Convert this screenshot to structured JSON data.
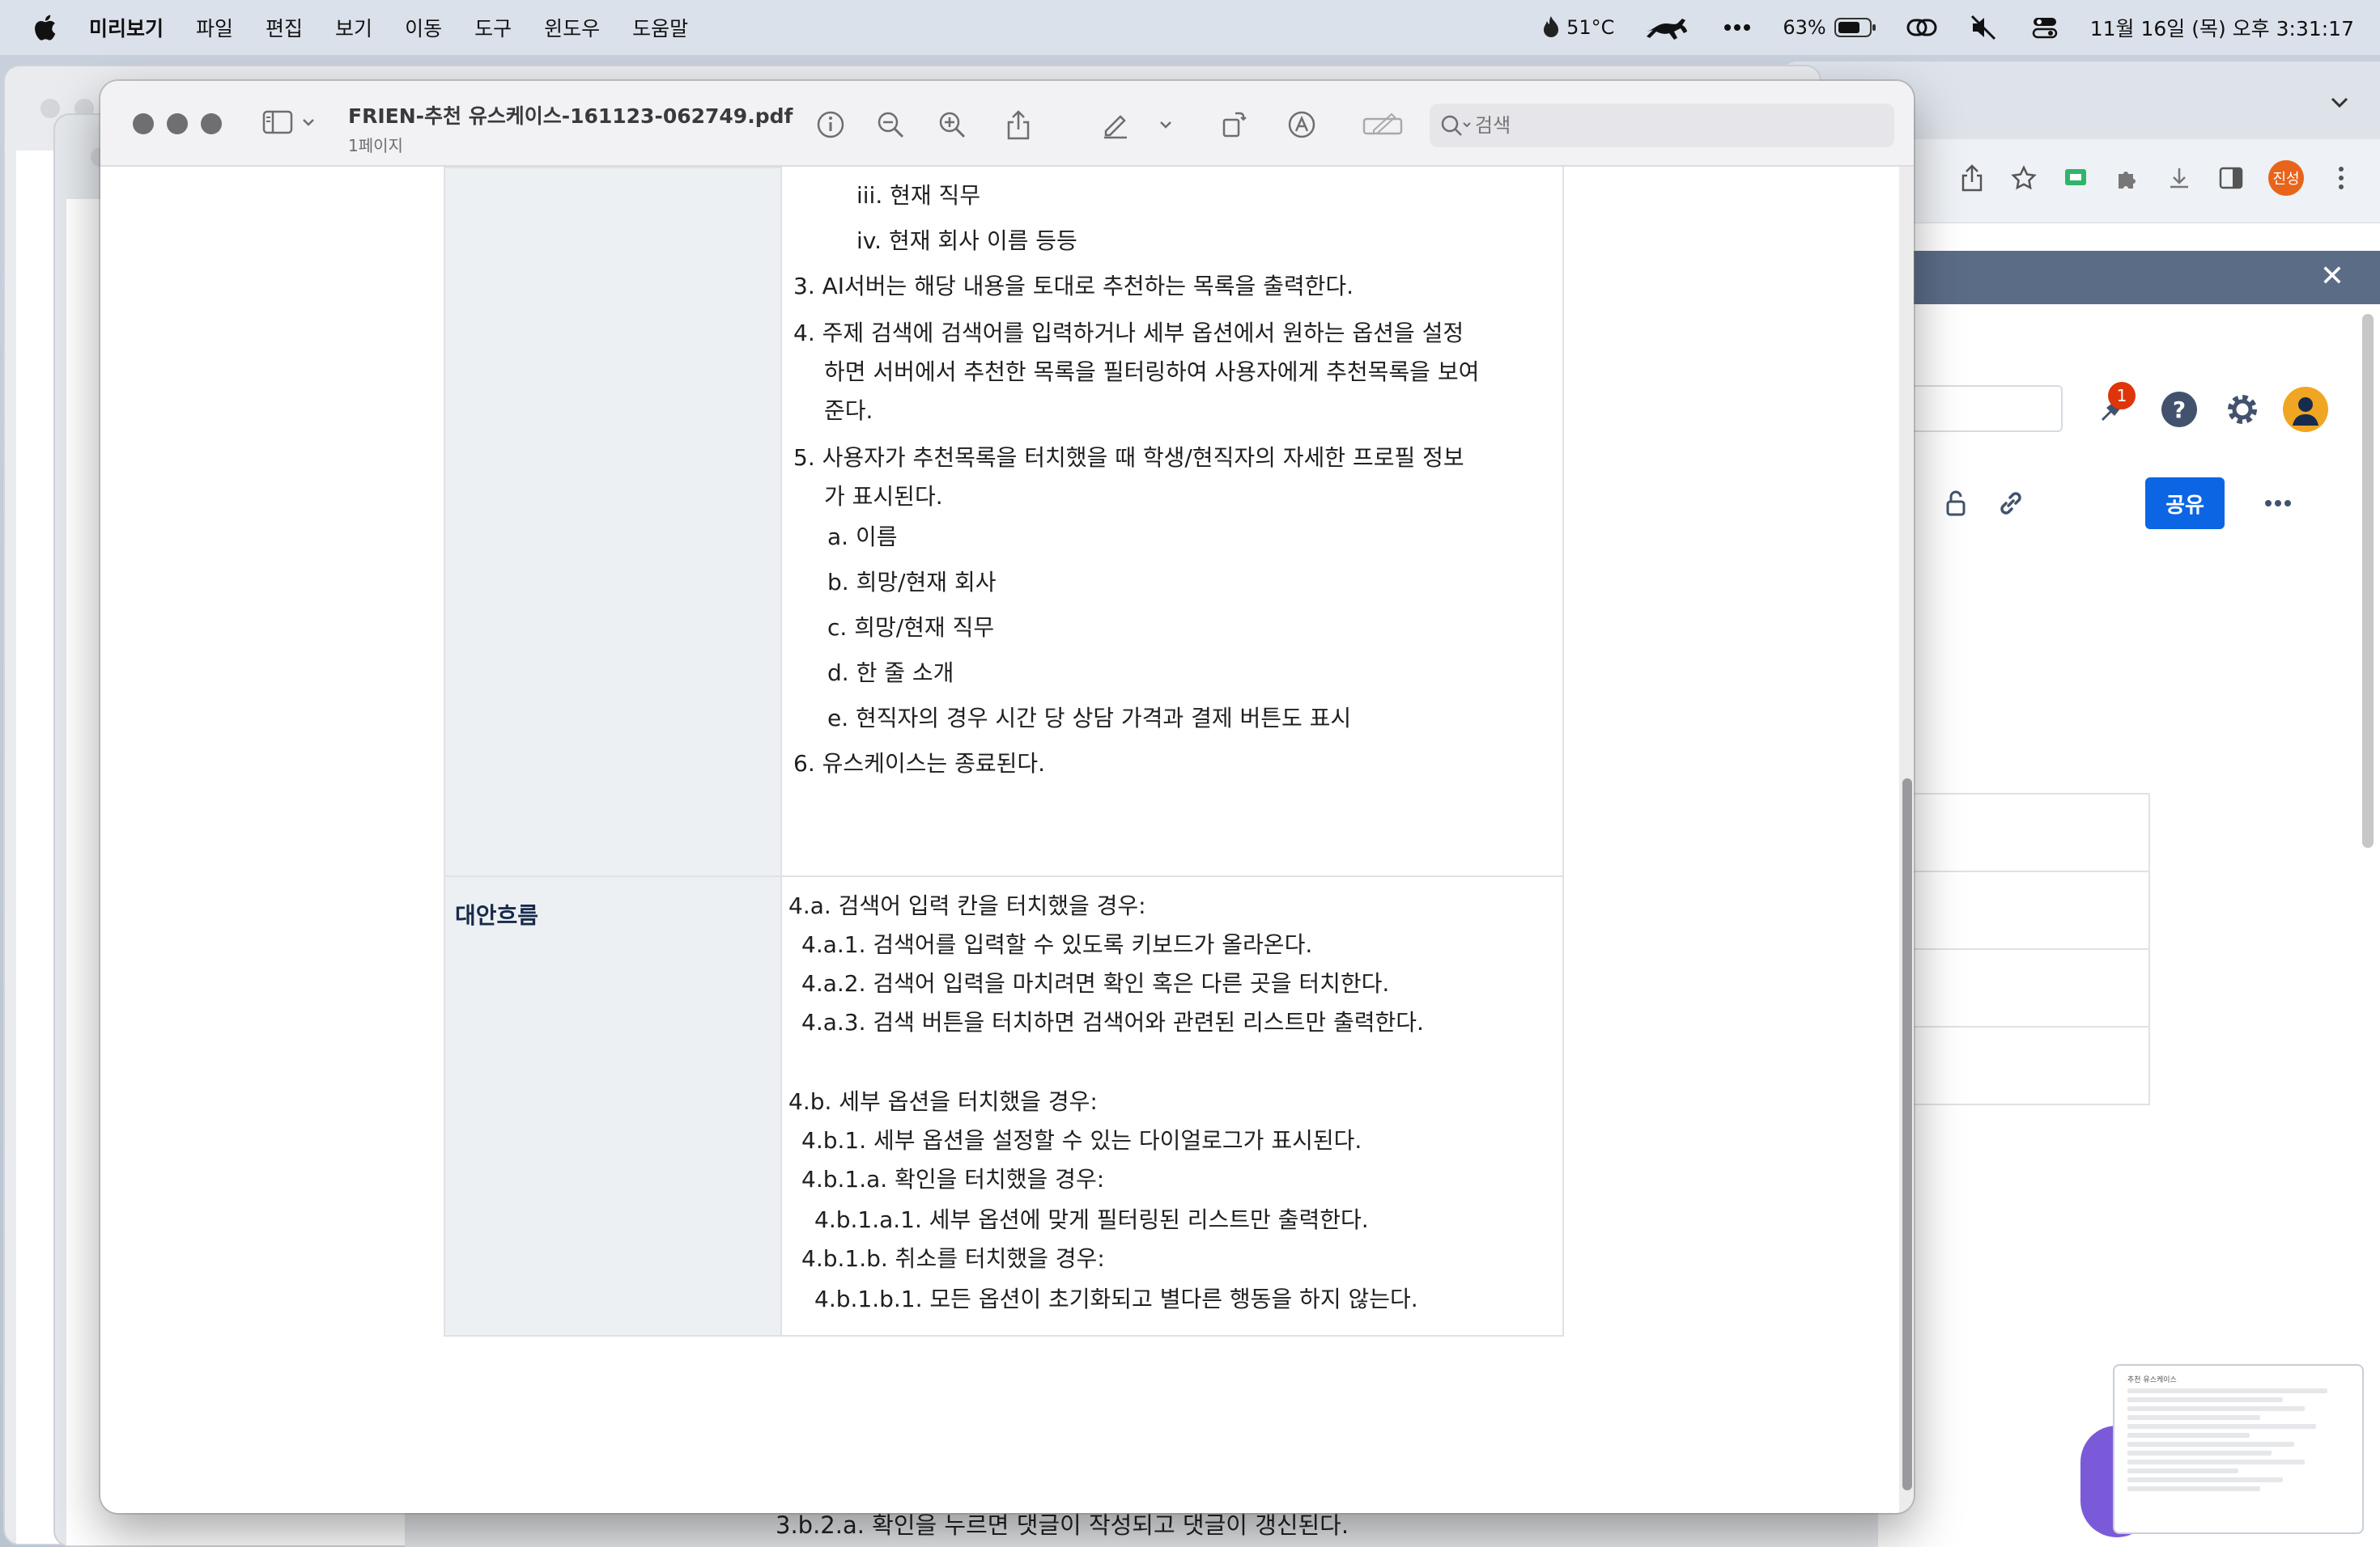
{
  "menubar": {
    "app_name": "미리보기",
    "items": [
      "파일",
      "편집",
      "보기",
      "이동",
      "도구",
      "윈도우",
      "도움말"
    ],
    "temperature": "51°C",
    "battery": "63%",
    "datetime": "11월 16일 (목) 오후 3:31:17"
  },
  "preview": {
    "filename": "FRIEN-추천 유스케이스-161123-062749.pdf",
    "page_label": "1페이지",
    "search_placeholder": "검색"
  },
  "document": {
    "main_flow_lines": [
      "iii. 현재 직무",
      "iv. 현재 회사 이름 등등",
      "3. AI서버는 해당 내용을 토대로 추천하는 목록을 출력한다.",
      "4. 주제 검색에 검색어를 입력하거나 세부 옵션에서 원하는 옵션을 설정",
      "하면 서버에서 추천한 목록을 필터링하여 사용자에게 추천목록을 보여",
      "준다.",
      "5. 사용자가 추천목록을 터치했을 때 학생/현직자의 자세한 프로필 정보",
      "가 표시된다.",
      "a. 이름",
      "b. 희망/현재 회사",
      "c. 희망/현재 직무",
      "d. 한 줄 소개",
      "e. 현직자의 경우 시간 당 상담 가격과 결제 버튼도 표시",
      "6. 유스케이스는 종료된다."
    ],
    "alt_flow_label": "대안흐름",
    "alt_flow_lines": [
      "4.a. 검색어 입력 칸을 터치했을 경우:",
      "4.a.1. 검색어를 입력할 수 있도록 키보드가 올라온다.",
      "4.a.2. 검색어 입력을 마치려면 확인 혹은 다른 곳을 터치한다.",
      "4.a.3. 검색 버튼을 터치하면 검색어와 관련된 리스트만 출력한다.",
      "4.b. 세부 옵션을 터치했을 경우:",
      "4.b.1. 세부 옵션을 설정할 수 있는 다이얼로그가 표시된다.",
      "4.b.1.a. 확인을 터치했을 경우:",
      "4.b.1.a.1. 세부 옵션에 맞게 필터링된 리스트만 출력한다.",
      "4.b.1.b. 취소를 터치했을 경우:",
      "4.b.1.b.1. 모든 옵션이 초기화되고 별다른 행동을 하지 않는다."
    ]
  },
  "browser": {
    "profile_name": "진성",
    "notification_count": "1",
    "share_label": "공유",
    "close_label": "✕",
    "help_label": "?",
    "thumbnail_title": "추천 유스케이스"
  },
  "background": {
    "bottom_text": "3.b.2.a. 확인을 누르면 댓글이 작성되고 댓글이 갱신된다."
  }
}
